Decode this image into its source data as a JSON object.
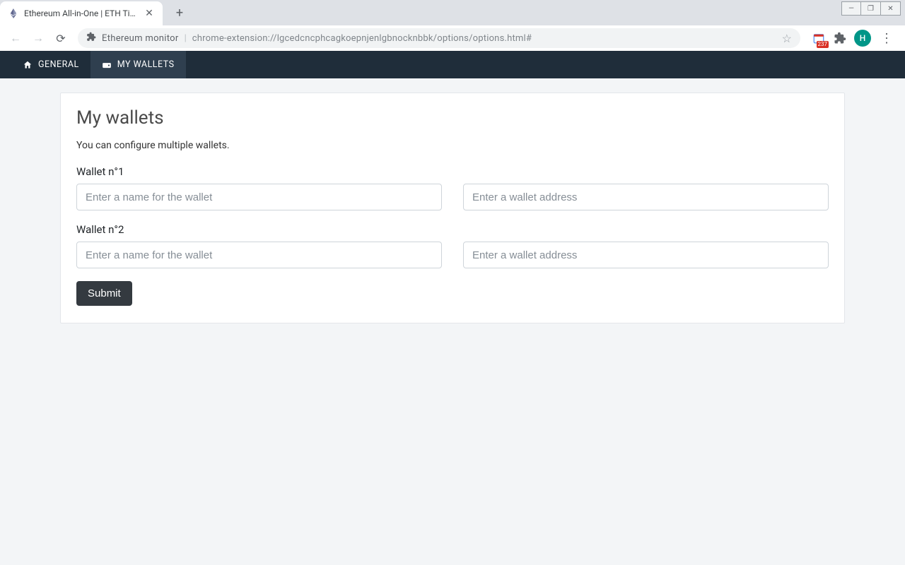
{
  "browser": {
    "tab_title": "Ethereum All-in-One | ETH Ticker",
    "omnibox_app": "Ethereum monitor",
    "omnibox_url": "chrome-extension://lgcedcncphcagkoepnjenlgbnocknbbk/options/options.html#",
    "avatar_letter": "H",
    "ext_badge": "237"
  },
  "nav": {
    "items": [
      {
        "label": "GENERAL",
        "icon": "home"
      },
      {
        "label": "MY WALLETS",
        "icon": "wallet"
      }
    ],
    "active_index": 1
  },
  "page": {
    "title": "My wallets",
    "subtitle": "You can configure multiple wallets.",
    "wallets": [
      {
        "label": "Wallet n°1",
        "name_placeholder": "Enter a name for the wallet",
        "addr_placeholder": "Enter a wallet address",
        "name_value": "",
        "addr_value": ""
      },
      {
        "label": "Wallet n°2",
        "name_placeholder": "Enter a name for the wallet",
        "addr_placeholder": "Enter a wallet address",
        "name_value": "",
        "addr_value": ""
      }
    ],
    "submit_label": "Submit"
  }
}
